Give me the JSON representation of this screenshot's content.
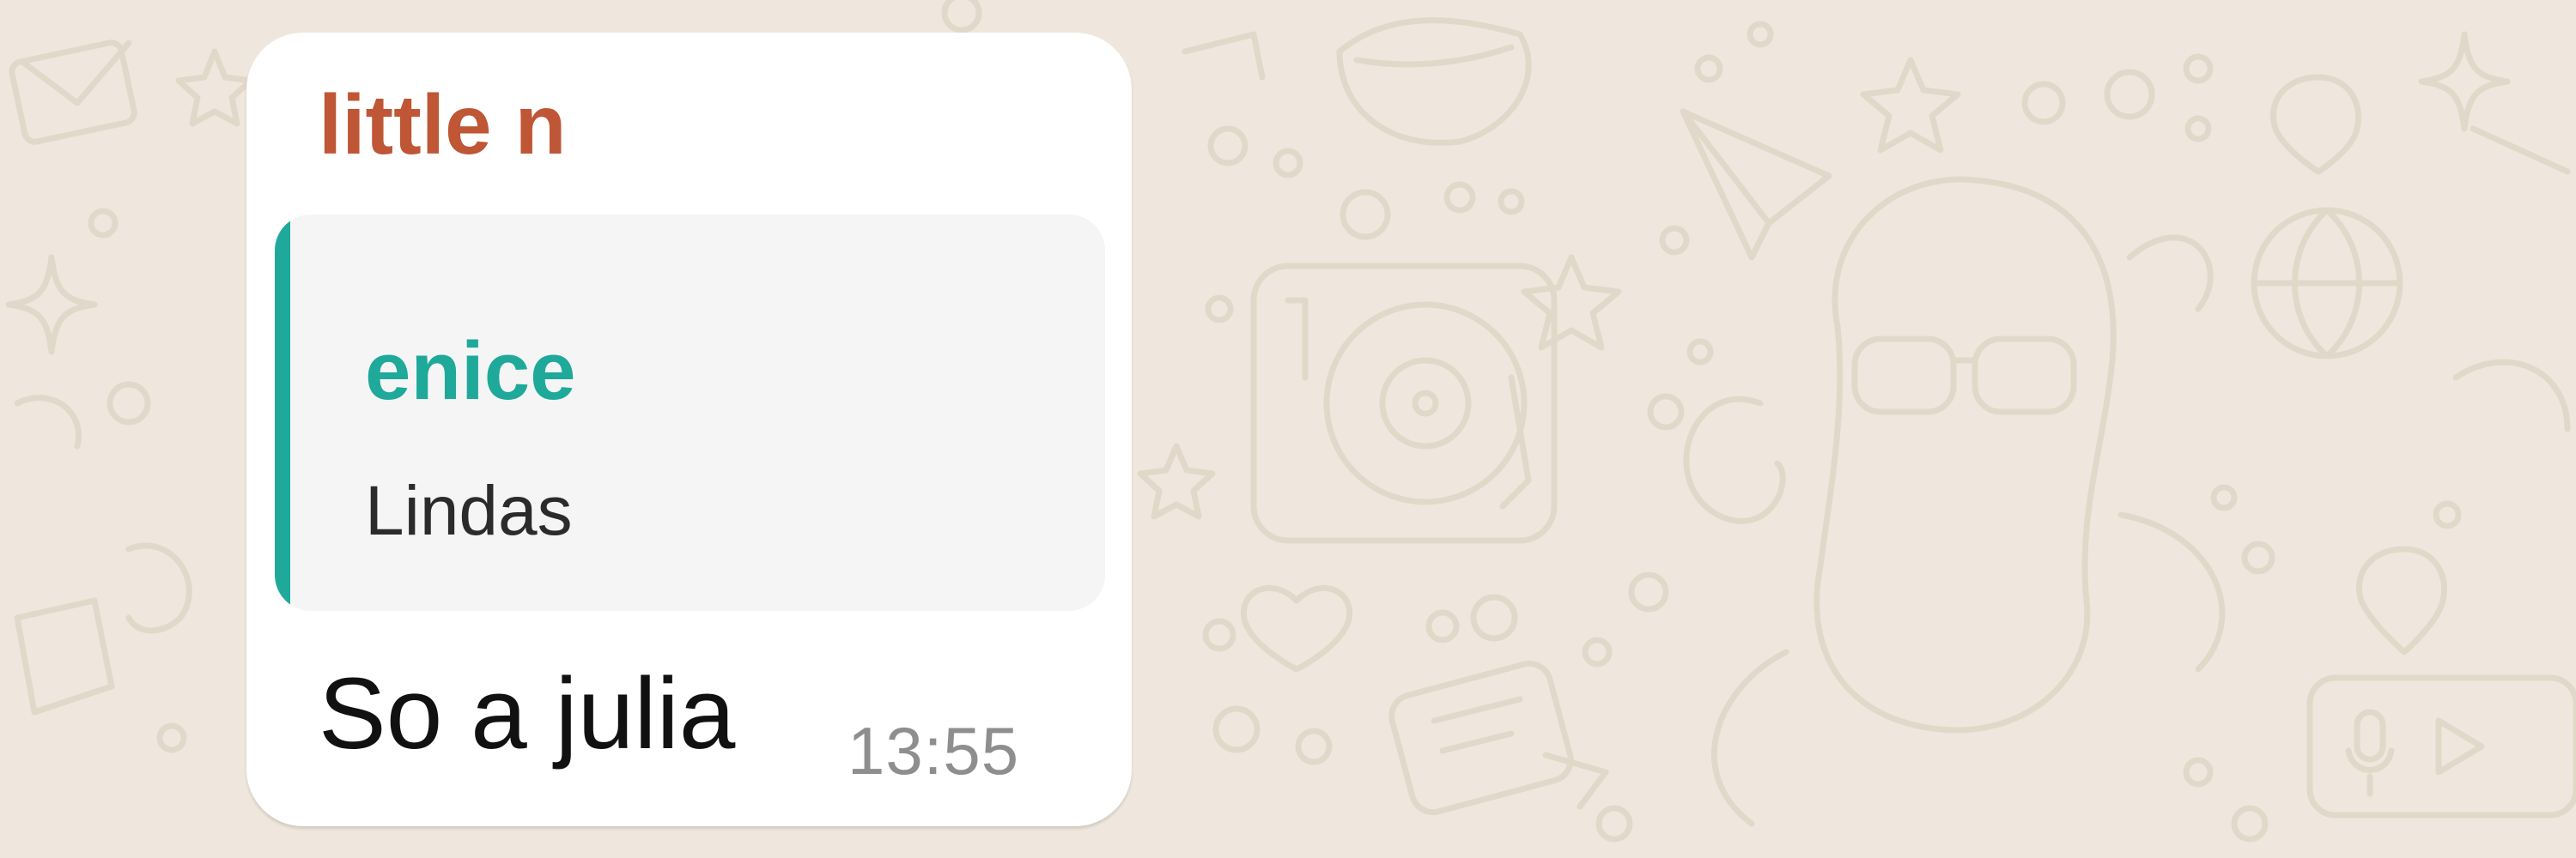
{
  "colors": {
    "wallpaper": "#EFE7DD",
    "doodle": "#E2D8CA",
    "bubble": "#FFFFFF",
    "sender_name": "#BF5635",
    "quote_accent": "#1FA99A",
    "quote_background": "#F5F5F5"
  },
  "message": {
    "sender": "little n",
    "quoted": {
      "author": "enice",
      "text": "Lindas"
    },
    "text": "So a julia",
    "time": "13:55"
  },
  "wallpaper": {
    "icons": [
      "envelope-icon",
      "lips-icon",
      "paper-plane-icon",
      "star-icon",
      "location-pin-icon",
      "turntable-icon",
      "sunglasses-icon",
      "basketball-icon",
      "heart-icon",
      "chat-bubble-icon",
      "microphone-icon",
      "play-icon",
      "sparkle-icon"
    ]
  }
}
